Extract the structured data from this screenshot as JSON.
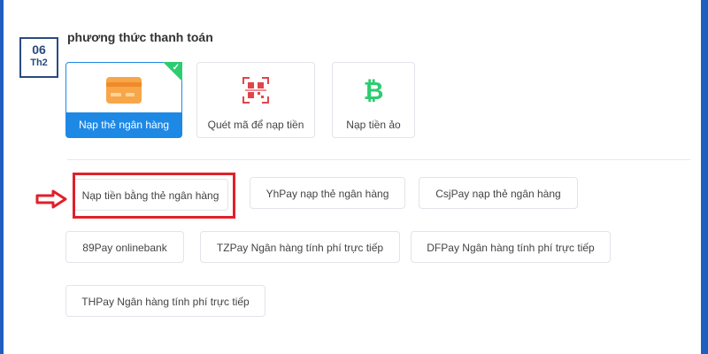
{
  "date": {
    "day": "06",
    "month": "Th2"
  },
  "section_title": "phương thức thanh toán",
  "payment_methods": [
    {
      "label": "Nạp thẻ ngân hàng",
      "icon": "bank-card-icon",
      "selected": true
    },
    {
      "label": "Quét mã để nạp tiền",
      "icon": "qr-code-icon",
      "selected": false
    },
    {
      "label": "Nạp tiền ảo",
      "icon": "bitcoin-icon",
      "selected": false
    }
  ],
  "options": [
    {
      "label": "Nạp tiền bằng thẻ ngân hàng",
      "highlighted": true
    },
    {
      "label": "YhPay nạp thẻ ngân hàng"
    },
    {
      "label": "CsjPay nạp thẻ ngân hàng"
    },
    {
      "label": "89Pay onlinebank"
    },
    {
      "label": "TZPay Ngân hàng tính phí trực tiếp"
    },
    {
      "label": "DFPay Ngân hàng tính phí trực tiếp"
    },
    {
      "label": "THPay Ngân hàng tính phí trực tiếp"
    }
  ],
  "colors": {
    "accent": "#1e88e5",
    "highlight": "#e0202b",
    "frame": "#1f5fbf"
  }
}
